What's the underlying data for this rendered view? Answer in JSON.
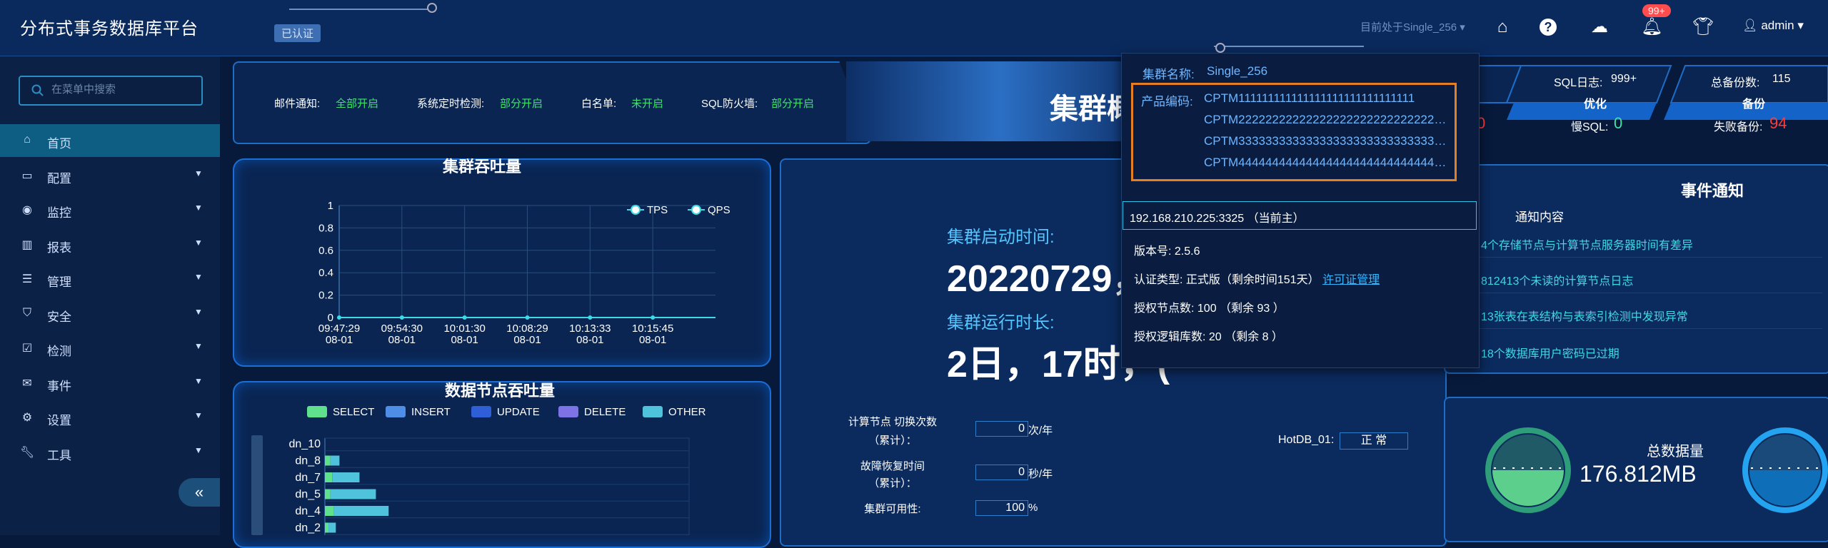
{
  "header": {
    "app_title": "分布式事务数据库平台",
    "cert_badge": "已认证",
    "cluster_indicator": "目前处于Single_256",
    "notification_count": "99+",
    "user": "admin"
  },
  "sidebar": {
    "search_placeholder": "在菜单中搜索",
    "items": [
      {
        "label": "首页",
        "icon": "home-icon"
      },
      {
        "label": "配置",
        "icon": "monitor-icon"
      },
      {
        "label": "监控",
        "icon": "eye-icon"
      },
      {
        "label": "报表",
        "icon": "bar-chart-icon"
      },
      {
        "label": "管理",
        "icon": "database-icon"
      },
      {
        "label": "安全",
        "icon": "shield-icon"
      },
      {
        "label": "检测",
        "icon": "checkbox-icon"
      },
      {
        "label": "事件",
        "icon": "mail-icon"
      },
      {
        "label": "设置",
        "icon": "gear-icon"
      },
      {
        "label": "工具",
        "icon": "wrench-icon"
      }
    ],
    "collapse": "«"
  },
  "status_bar": {
    "items": [
      {
        "label": "邮件通知:",
        "value": "全部开启"
      },
      {
        "label": "系统定时检测:",
        "value": "部分开启"
      },
      {
        "label": "白名单:",
        "value": "未开启"
      },
      {
        "label": "SQL防火墙:",
        "value": "部分开启"
      }
    ],
    "big_title": "集群概"
  },
  "throughput": {
    "title": "集群吞吐量",
    "legend": [
      "TPS",
      "QPS"
    ],
    "y_ticks": [
      "1",
      "0.8",
      "0.6",
      "0.4",
      "0.2",
      "0"
    ],
    "x_ticks": [
      {
        "time": "09:47:29",
        "date": "08-01"
      },
      {
        "time": "09:54:30",
        "date": "08-01"
      },
      {
        "time": "10:01:30",
        "date": "08-01"
      },
      {
        "time": "10:08:29",
        "date": "08-01"
      },
      {
        "time": "10:13:33",
        "date": "08-01"
      },
      {
        "time": "10:15:45",
        "date": "08-01"
      }
    ]
  },
  "chart_data": {
    "type": "bar",
    "title": "数据节点吞吐量",
    "legend": [
      "SELECT",
      "INSERT",
      "UPDATE",
      "DELETE",
      "OTHER"
    ],
    "colors": [
      "#5ee08c",
      "#4f8ee6",
      "#2e5fd6",
      "#7d72e6",
      "#4fc3dc"
    ],
    "categories": [
      "dn_10",
      "dn_8",
      "dn_7",
      "dn_5",
      "dn_4",
      "dn_2"
    ],
    "series": [
      {
        "name": "SELECT",
        "values": [
          0,
          0.3,
          0.4,
          0.3,
          0.5,
          0.2
        ]
      },
      {
        "name": "OTHER",
        "values": [
          0,
          0.5,
          1.5,
          2.5,
          3.0,
          0.4
        ]
      }
    ]
  },
  "center": {
    "start_label": "集群启动时间:",
    "start_value": "20220729，",
    "run_label": "集群运行时长:",
    "run_value": "2日，17时，(",
    "stats": [
      {
        "label_1": "计算节点 切换次数",
        "label_2": "（累计）：",
        "value": "0",
        "unit": "次/年"
      },
      {
        "label_1": "故障恢复时间",
        "label_2": "（累计）：",
        "value": "0",
        "unit": "秒/年"
      },
      {
        "label_1": "集群可用性:",
        "label_2": "",
        "value": "100",
        "unit": "%"
      }
    ],
    "hotdb_label": "HotDB_01:",
    "hotdb_status": "正 常"
  },
  "sql_panel": {
    "sql_log_label": "SQL日志:",
    "sql_log_value": "999+",
    "backup_label": "总备份数:",
    "backup_value": "115",
    "optimize_label": "优化",
    "backup_tab": "备份",
    "slow_sql_label": "慢SQL:",
    "slow_sql_value": "0",
    "fail_backup_label": "失败备份:",
    "fail_backup_value": "94",
    "left_partial": "0"
  },
  "events": {
    "title": "事件通知",
    "column": "通知内容",
    "rows": [
      "4个存储节点与计算节点服务器时间有差异",
      "812413个未读的计算节点日志",
      "13张表在表结构与表索引检测中发现异常",
      "18个数据库用户密码已过期"
    ]
  },
  "storage": {
    "total_label": "总数据量",
    "total_value": "176.812MB"
  },
  "popup": {
    "name_label": "集群名称:",
    "name_value": "Single_256",
    "product_label": "产品编码:",
    "product_codes": [
      "CPTM111111111111111111111111111111",
      "CPTM22222222222222222222222222222222...",
      "CPTM33333333333333333333333333333333...",
      "CPTM44444444444444444444444444444444..."
    ],
    "host": "192.168.210.225:3325 （当前主）",
    "version": "版本号: 2.5.6",
    "auth_label": "认证类型:",
    "auth_value": "正式版（剩余时间151天）",
    "auth_link": "许可证管理",
    "auth_nodes": "授权节点数: 100 （剩余 93 ）",
    "auth_logic": "授权逻辑库数: 20 （剩余 8 ）"
  }
}
